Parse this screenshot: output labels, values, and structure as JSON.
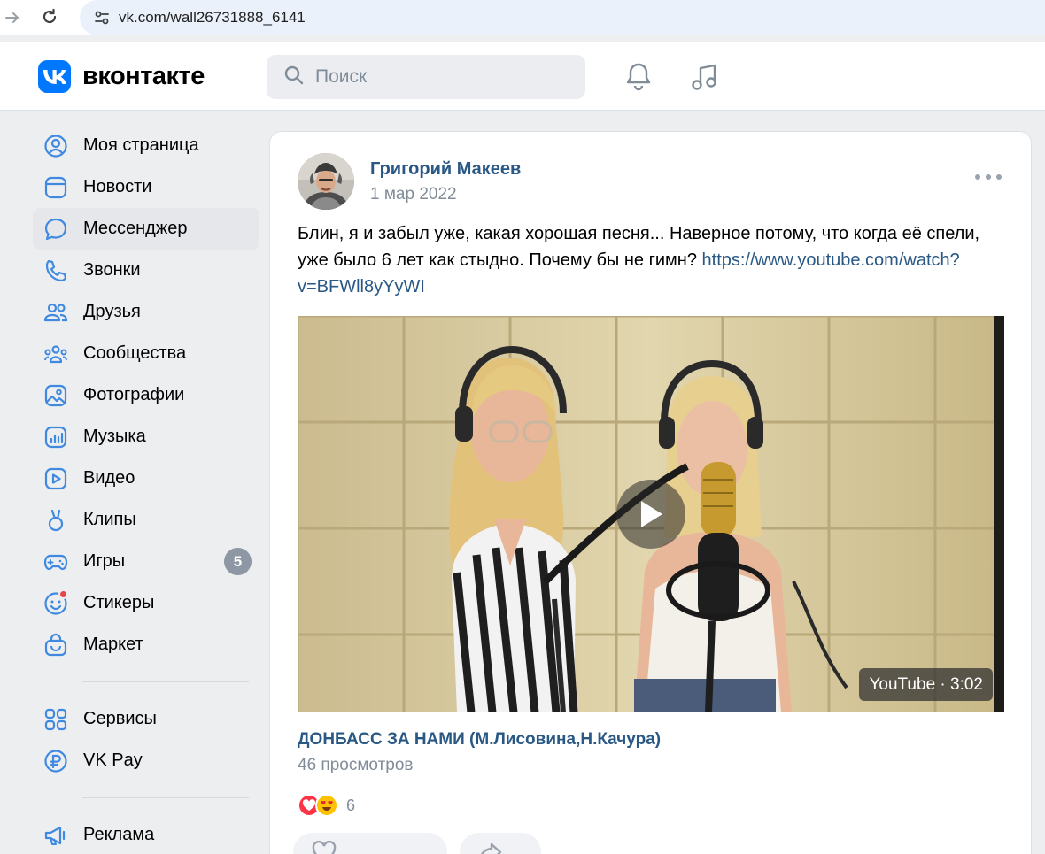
{
  "browser": {
    "url": "vk.com/wall26731888_6141"
  },
  "header": {
    "logo_text": "вконтакте",
    "search_placeholder": "Поиск"
  },
  "sidebar": {
    "items": [
      {
        "label": "Моя страница",
        "icon": "user-circle-icon"
      },
      {
        "label": "Новости",
        "icon": "newsfeed-icon"
      },
      {
        "label": "Мессенджер",
        "icon": "message-icon",
        "active": true
      },
      {
        "label": "Звонки",
        "icon": "phone-icon"
      },
      {
        "label": "Друзья",
        "icon": "friends-icon"
      },
      {
        "label": "Сообщества",
        "icon": "communities-icon"
      },
      {
        "label": "Фотографии",
        "icon": "photos-icon"
      },
      {
        "label": "Музыка",
        "icon": "music-icon"
      },
      {
        "label": "Видео",
        "icon": "video-icon"
      },
      {
        "label": "Клипы",
        "icon": "clips-icon"
      },
      {
        "label": "Игры",
        "icon": "gamepad-icon",
        "badge": "5"
      },
      {
        "label": "Стикеры",
        "icon": "sticker-icon"
      },
      {
        "label": "Маркет",
        "icon": "market-bag-icon"
      }
    ],
    "items2": [
      {
        "label": "Сервисы",
        "icon": "services-grid-icon"
      },
      {
        "label": "VK Pay",
        "icon": "vkpay-ruble-icon"
      }
    ],
    "items3": [
      {
        "label": "Реклама",
        "icon": "megaphone-icon"
      }
    ]
  },
  "post": {
    "author": "Григорий Макеев",
    "date": "1 мар 2022",
    "text": "Блин, я и забыл уже, какая хорошая песня... Наверное потому, что когда её спели, уже было 6 лет как стыдно. Почему бы не гимн?",
    "link": "https://www.youtube.com/watch?v=BFWll8yYyWI",
    "video": {
      "duration_label": "YouTube · 3:02",
      "title": "ДОНБАСС ЗА НАМИ (М.Лисовина,Н.Качура)",
      "views": "46 просмотров"
    },
    "reactions": {
      "count": "6"
    }
  },
  "colors": {
    "accent": "#0077ff",
    "link": "#2a5885",
    "muted": "#818c99",
    "badge": "#8e98a5",
    "notification": "#e64646"
  }
}
